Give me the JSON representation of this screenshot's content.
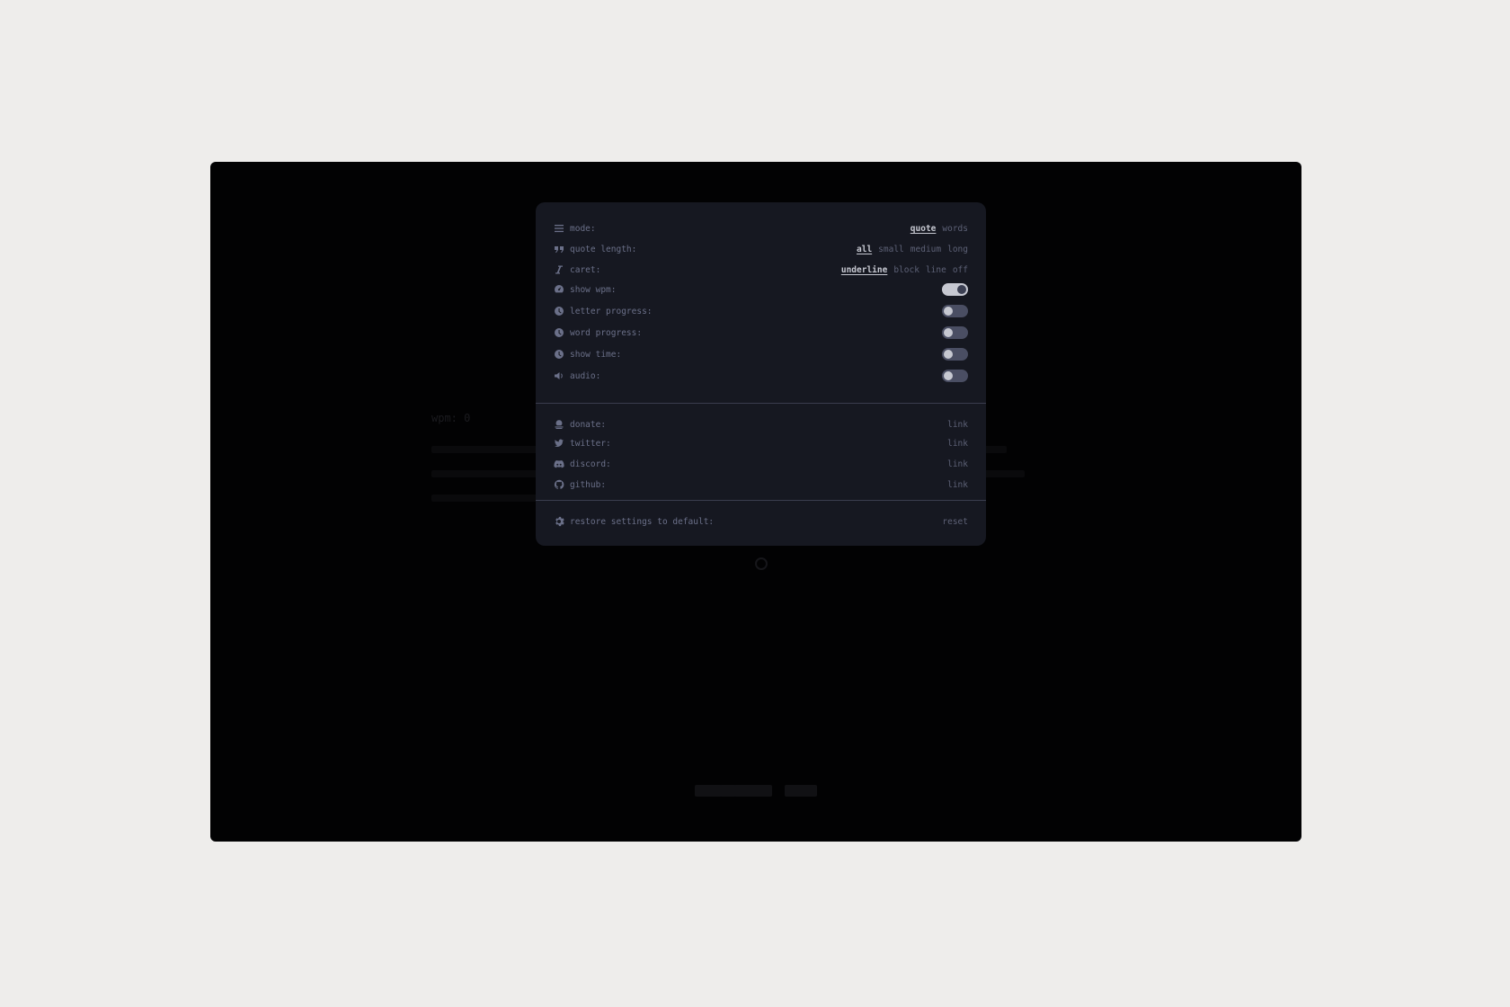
{
  "background_app": {
    "wpm_label": "wpm: 0"
  },
  "settings": {
    "mode": {
      "label": "mode:",
      "options": [
        "quote",
        "words"
      ],
      "selected": "quote"
    },
    "quote_length": {
      "label": "quote length:",
      "options": [
        "all",
        "small",
        "medium",
        "long"
      ],
      "selected": "all"
    },
    "caret": {
      "label": "caret:",
      "options": [
        "underline",
        "block",
        "line",
        "off"
      ],
      "selected": "underline"
    },
    "toggles": [
      {
        "label": "show wpm:",
        "icon": "gauge-icon",
        "on": true
      },
      {
        "label": "letter progress:",
        "icon": "clock-icon",
        "on": false
      },
      {
        "label": "word progress:",
        "icon": "clock-icon",
        "on": false
      },
      {
        "label": "show time:",
        "icon": "clock-icon",
        "on": false
      },
      {
        "label": "audio:",
        "icon": "speaker-icon",
        "on": false
      }
    ],
    "links": [
      {
        "label": "donate:",
        "icon": "donate-icon",
        "link_text": "link"
      },
      {
        "label": "twitter:",
        "icon": "twitter-icon",
        "link_text": "link"
      },
      {
        "label": "discord:",
        "icon": "discord-icon",
        "link_text": "link"
      },
      {
        "label": "github:",
        "icon": "github-icon",
        "link_text": "link"
      }
    ],
    "restore": {
      "label": "restore settings to default:",
      "button": "reset"
    }
  },
  "colors": {
    "modal_bg": "#161821",
    "text": "#6b7089",
    "selected": "#c6c8d1",
    "toggle_off": "#4a4e63"
  }
}
